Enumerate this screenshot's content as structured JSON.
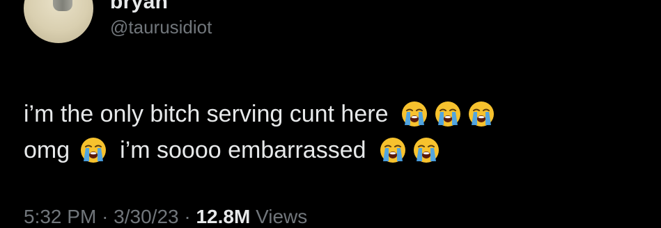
{
  "user": {
    "display_name": "bryan",
    "handle": "@taurusidiot"
  },
  "tweet": {
    "line1_text": "i’m the only bitch serving cunt here",
    "line2_text_a": "omg",
    "line2_text_b": "i’m soooo embarrassed",
    "emoji_name": "loudly-crying-face"
  },
  "meta": {
    "time": "5:32 PM",
    "date": "3/30/23",
    "separator": "·",
    "views_count": "12.8M",
    "views_label": "Views"
  },
  "colors": {
    "background": "#000000",
    "primary_text": "#e7e9ea",
    "secondary_text": "#71767b",
    "emoji_yellow": "#f7c22e",
    "emoji_tear": "#4aa3e8"
  }
}
